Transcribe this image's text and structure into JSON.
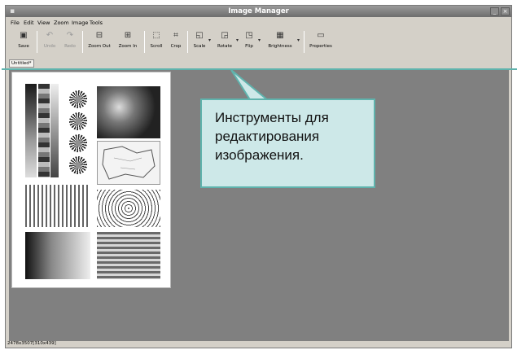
{
  "window": {
    "title": "Image Manager",
    "minimize_symbol": "_",
    "close_symbol": "×"
  },
  "menu": [
    "File",
    "Edit",
    "View",
    "Zoom",
    "Image",
    "Tools"
  ],
  "toolbar": {
    "save": "Save",
    "undo": "Undo",
    "redo": "Redo",
    "zoom_out": "Zoom Out",
    "zoom_in": "Zoom In",
    "scroll": "Scroll",
    "crop": "Crop",
    "scale": "Scale",
    "rotate": "Rotate",
    "flip": "Flip",
    "brightness": "Brightness",
    "properties": "Properties",
    "dropdown_symbol": "▾"
  },
  "document_tab": "Untitled*",
  "status": "2478x3507[310x439]",
  "callout": {
    "line1": "Инструменты для",
    "line2": "редактирования",
    "line3": "изображения."
  },
  "colors": {
    "accent": "#5fb3ad",
    "callout_fill": "#cde8e8",
    "workspace": "#808080",
    "chrome": "#d4d0c8"
  },
  "icons": {
    "save": "floppy-icon",
    "undo": "undo-arrow-icon",
    "redo": "redo-arrow-icon",
    "zoom_out": "zoom-out-icon",
    "zoom_in": "zoom-in-icon",
    "scroll": "scroll-icon",
    "crop": "crop-icon",
    "scale": "scale-icon",
    "rotate": "rotate-icon",
    "flip": "flip-icon",
    "brightness": "brightness-icon",
    "properties": "properties-icon"
  }
}
